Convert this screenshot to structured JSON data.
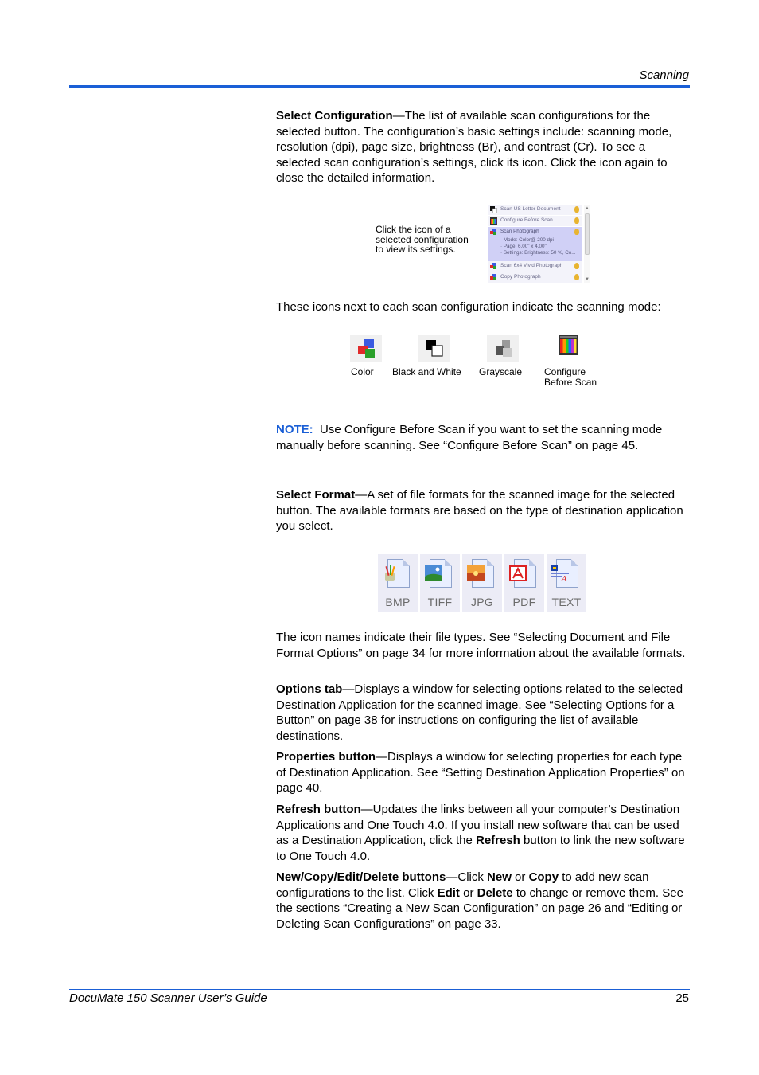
{
  "header": {
    "section_title": "Scanning"
  },
  "footer": {
    "guide_title": "DocuMate 150 Scanner User’s Guide",
    "page_number": "25"
  },
  "select_configuration": {
    "term": "Select Configuration",
    "text": "—The list of available scan configurations for the selected button. The configuration’s basic settings include: scanning mode, resolution (dpi), page size, brightness (Br), and contrast (Cr). To see a selected scan configuration’s settings, click its icon. Click the icon again to close the detailed information."
  },
  "config_figure": {
    "callout": "Click the icon of a selected configuration to view its settings.",
    "items": [
      {
        "label": "Scan US Letter Document",
        "mode": "black-and-white"
      },
      {
        "label": "Configure Before Scan",
        "mode": "configure-before-scan"
      },
      {
        "label": "Scan Photograph",
        "mode": "color",
        "selected": true,
        "details": [
          "· Mode: Color@ 200 dpi",
          "· Page:  6.00\" x  4.00\"",
          "· Settings: Brightness: 50 %, Co..."
        ]
      },
      {
        "label": "Scan 6x4 Vivid Photograph",
        "mode": "color"
      },
      {
        "label": "Copy Photograph",
        "mode": "color"
      }
    ],
    "scroll_up": "▲",
    "scroll_down": "▼"
  },
  "modes_intro": "These icons next to each scan configuration indicate the scanning mode:",
  "modes": [
    {
      "label": "Color",
      "icon": "color-mode-icon"
    },
    {
      "label": "Black and White",
      "icon": "black-and-white-mode-icon"
    },
    {
      "label": "Grayscale",
      "icon": "grayscale-mode-icon"
    },
    {
      "label": "Configure Before Scan",
      "icon": "configure-before-scan-icon"
    }
  ],
  "note": {
    "label": "NOTE:",
    "text": "Use Configure Before Scan if you want to set the scanning mode manually before scanning. See “Configure Before Scan” on page 45."
  },
  "select_format": {
    "term": "Select Format",
    "text": "—A set of file formats for the scanned image for the selected button. The available formats are based on the type of destination application you select."
  },
  "formats": [
    {
      "label": "BMP",
      "icon": "bmp-file-icon"
    },
    {
      "label": "TIFF",
      "icon": "tiff-file-icon"
    },
    {
      "label": "JPG",
      "icon": "jpg-file-icon"
    },
    {
      "label": "PDF",
      "icon": "pdf-file-icon"
    },
    {
      "label": "TEXT",
      "icon": "text-file-icon"
    }
  ],
  "icon_names_para": "The icon names indicate their file types. See “Selecting Document and File Format Options” on page 34 for more information about the available formats.",
  "options_tab": {
    "term": "Options tab",
    "text": "—Displays a window for selecting options related to the selected Destination Application for the scanned image. See “Selecting Options for a Button” on page 38 for instructions on configuring the list of available destinations."
  },
  "properties_button": {
    "term": "Properties button",
    "text": "—Displays a window for selecting properties for each type of Destination Application. See “Setting Destination Application Properties” on page 40."
  },
  "refresh_button": {
    "term": "Refresh button",
    "text_1": "—Updates the links between all your computer’s Destination Applications and One Touch 4.0. If you install new software that can be used as a Destination Application, click the ",
    "bold_refresh": "Refresh",
    "text_2": " button to link the new software to One Touch 4.0."
  },
  "new_copy_edit_delete": {
    "term": "New/Copy/Edit/Delete buttons",
    "t1": "—Click ",
    "b_new": "New",
    "t2": " or ",
    "b_copy": "Copy",
    "t3": " to add new scan configurations to the list. Click ",
    "b_edit": "Edit",
    "t4": " or ",
    "b_delete": "Delete",
    "t5": " to change or remove them. See the sections “Creating a New Scan Configuration” on page 26 and “Editing or Deleting Scan Configurations” on page 33."
  }
}
